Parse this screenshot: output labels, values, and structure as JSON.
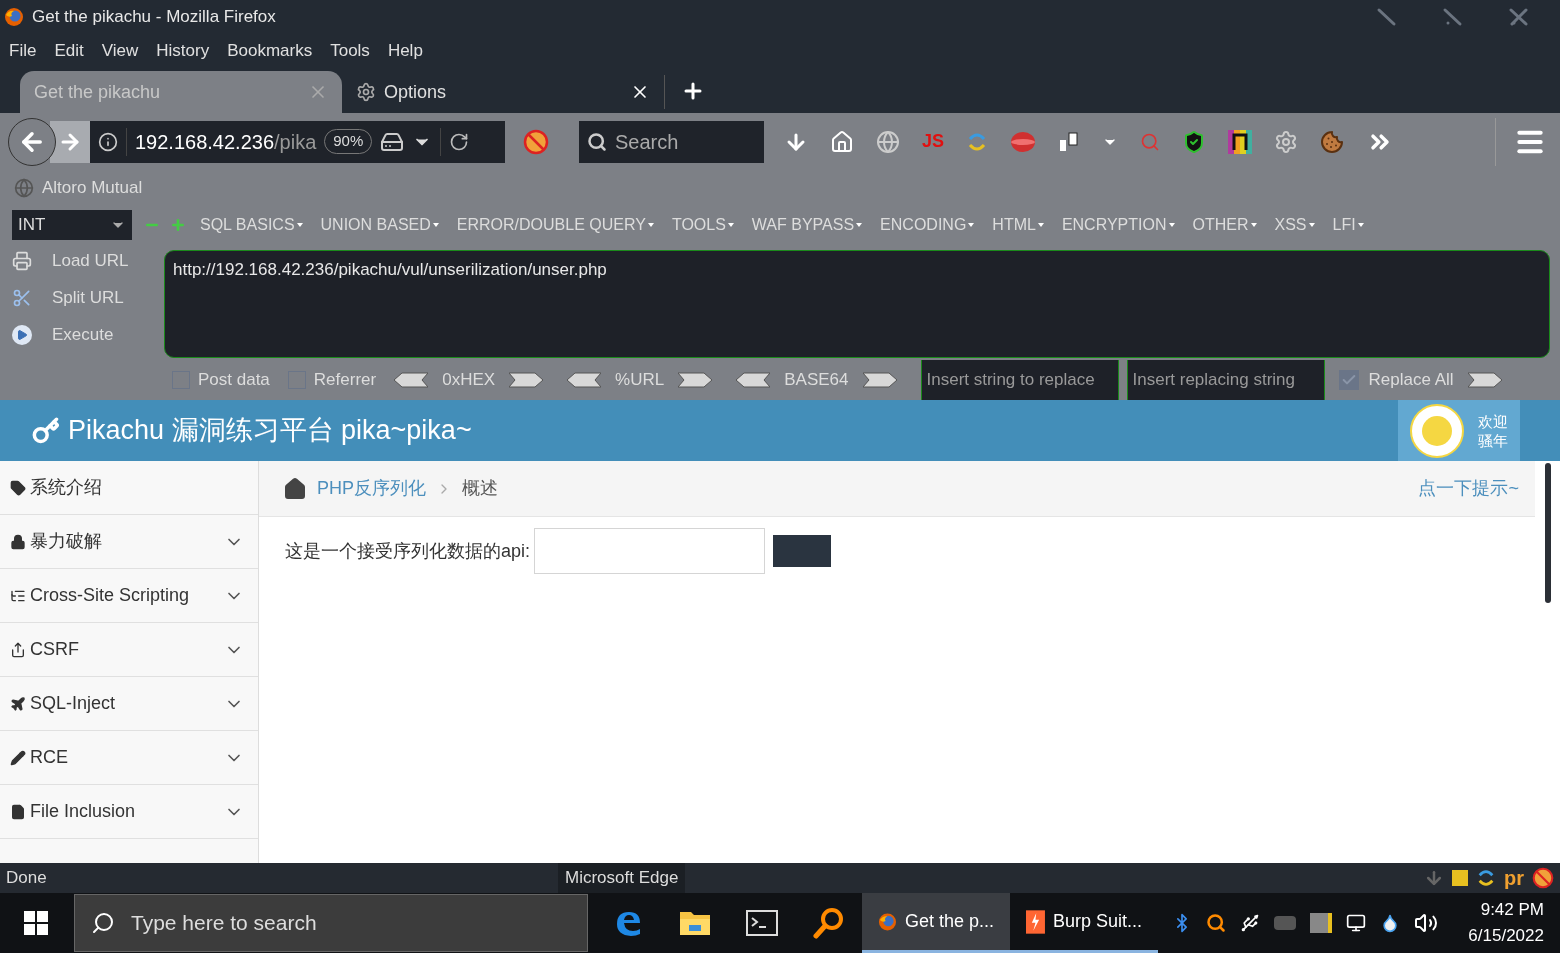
{
  "window": {
    "title": "Get the pikachu - Mozilla Firefox"
  },
  "menu": [
    {
      "label": "File"
    },
    {
      "label": "Edit"
    },
    {
      "label": "View"
    },
    {
      "label": "History"
    },
    {
      "label": "Bookmarks"
    },
    {
      "label": "Tools"
    },
    {
      "label": "Help"
    }
  ],
  "tabs": [
    {
      "label": "Get the pikachu",
      "selected": true,
      "kind": "page"
    },
    {
      "label": "Options",
      "selected": false,
      "kind": "settings"
    }
  ],
  "navbar": {
    "url_host": "192.168.42.236",
    "url_path": "/pika",
    "zoom": "90%",
    "search_placeholder": "Search",
    "js_label": "JS"
  },
  "bookmarks": [
    {
      "label": "Altoro Mutual"
    }
  ],
  "hackbar": {
    "encoding": "INT",
    "menus": [
      "SQL BASICS",
      "UNION BASED",
      "ERROR/DOUBLE QUERY",
      "TOOLS",
      "WAF BYPASS",
      "ENCODING",
      "HTML",
      "ENCRYPTION",
      "OTHER",
      "XSS",
      "LFI"
    ],
    "actions": [
      {
        "label": "Load URL",
        "kind": "load"
      },
      {
        "label": "Split URL",
        "kind": "split"
      },
      {
        "label": "Execute",
        "kind": "execute"
      }
    ],
    "url": "http://192.168.42.236/pikachu/vul/unserilization/unser.php",
    "options": [
      {
        "label": "Post data",
        "checked": false
      },
      {
        "label": "Referrer",
        "checked": false
      }
    ],
    "encoders": [
      "0xHEX",
      "%URL",
      "BASE64"
    ],
    "replace_placeholder": "Insert string to replace",
    "replacing_placeholder": "Insert replacing string",
    "replace_all": {
      "label": "Replace All",
      "checked": true
    }
  },
  "page": {
    "title": "Pikachu 漏洞练习平台 pika~pika~",
    "welcome": [
      "欢迎",
      "骚年"
    ],
    "sidebar": [
      {
        "label": "系统介绍",
        "kind": "tag",
        "expandable": false
      },
      {
        "label": "暴力破解",
        "kind": "lock",
        "expandable": true
      },
      {
        "label": "Cross-Site Scripting",
        "kind": "list",
        "expandable": true
      },
      {
        "label": "CSRF",
        "kind": "share",
        "expandable": true
      },
      {
        "label": "SQL-Inject",
        "kind": "plane",
        "expandable": true
      },
      {
        "label": "RCE",
        "kind": "pencil",
        "expandable": true
      },
      {
        "label": "File Inclusion",
        "kind": "file",
        "expandable": true
      }
    ],
    "breadcrumb": [
      {
        "label": "PHP反序列化",
        "link": true
      },
      {
        "label": "概述",
        "link": false
      }
    ],
    "hint": "点一下提示~",
    "form_label": "这是一个接受序列化数据的api:"
  },
  "status_bar": {
    "text": "Done",
    "tooltip": "Microsoft Edge",
    "tray_label": "pr"
  },
  "taskbar": {
    "search_placeholder": "Type here to search",
    "apps": [
      {
        "kind": "edge",
        "open": false,
        "selected": false
      },
      {
        "kind": "explorer",
        "open": false,
        "selected": false
      },
      {
        "kind": "terminal",
        "open": false,
        "selected": false
      },
      {
        "kind": "finder",
        "open": false,
        "selected": false
      },
      {
        "kind": "firefox",
        "label": "Get the p...",
        "open": true,
        "selected": true
      },
      {
        "kind": "burp",
        "label": "Burp Suit...",
        "open": true,
        "selected": false
      }
    ],
    "time": "9:42 PM",
    "date": "6/15/2022"
  }
}
